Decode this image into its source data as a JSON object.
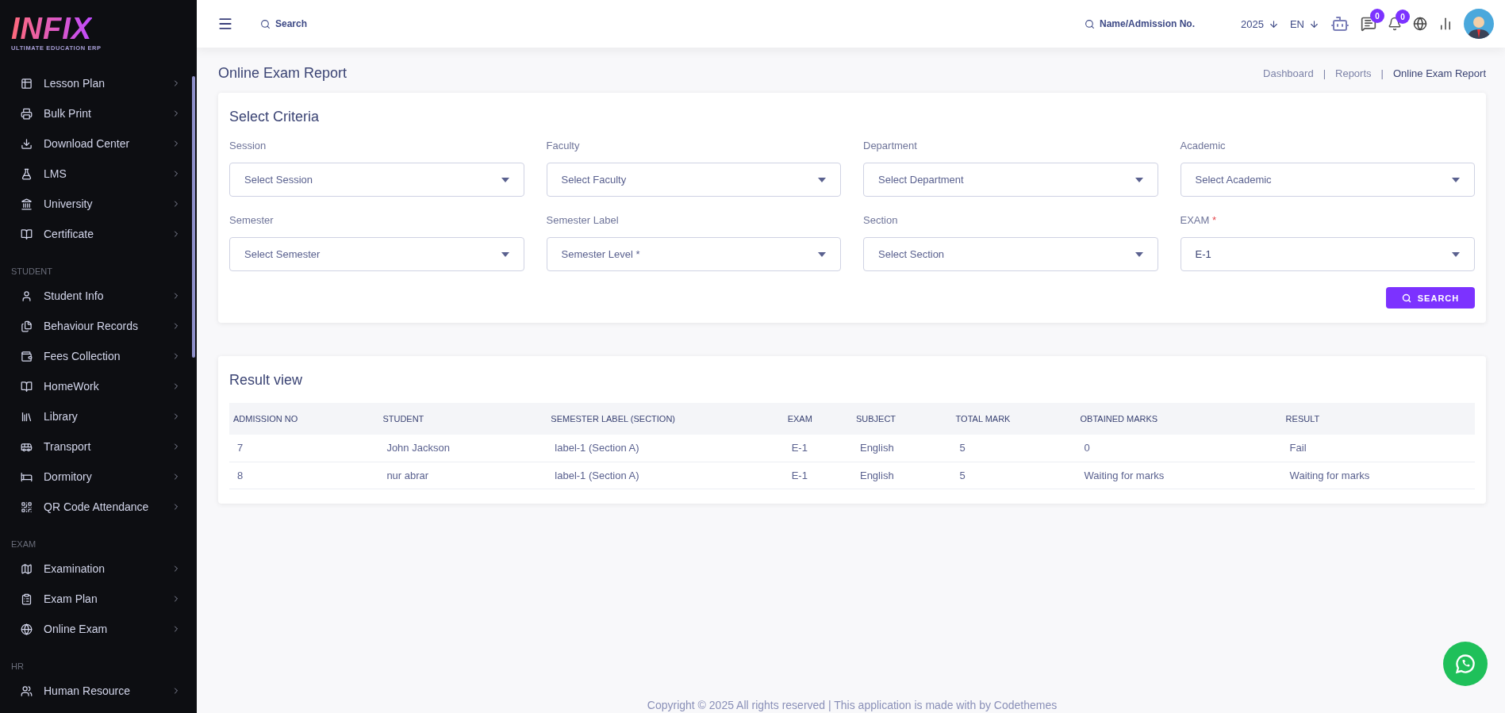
{
  "logo": {
    "wordmark": "INFIX",
    "tagline": "ULTIMATE EDUCATION ERP"
  },
  "sidebar": {
    "sections": [
      {
        "items": [
          {
            "label": "Lesson Plan"
          },
          {
            "label": "Bulk Print"
          },
          {
            "label": "Download Center"
          },
          {
            "label": "LMS"
          },
          {
            "label": "University"
          },
          {
            "label": "Certificate"
          }
        ]
      },
      {
        "title": "STUDENT",
        "items": [
          {
            "label": "Student Info"
          },
          {
            "label": "Behaviour Records"
          },
          {
            "label": "Fees Collection"
          },
          {
            "label": "HomeWork"
          },
          {
            "label": "Library"
          },
          {
            "label": "Transport"
          },
          {
            "label": "Dormitory"
          },
          {
            "label": "QR Code Attendance"
          }
        ]
      },
      {
        "title": "EXAM",
        "items": [
          {
            "label": "Examination"
          },
          {
            "label": "Exam Plan"
          },
          {
            "label": "Online Exam"
          }
        ]
      },
      {
        "title": "HR",
        "items": [
          {
            "label": "Human Resource"
          }
        ]
      }
    ]
  },
  "header": {
    "search": "Search",
    "student_search": "Name/Admission No.",
    "year": "2025",
    "language": "EN",
    "message_count": "0",
    "notification_count": "0"
  },
  "page": {
    "title": "Online Exam Report",
    "breadcrumb": [
      {
        "kind": "link",
        "text": "Dashboard"
      },
      {
        "kind": "separator",
        "text": "|"
      },
      {
        "kind": "link",
        "text": "Reports"
      },
      {
        "kind": "separator",
        "text": "|"
      },
      {
        "kind": "current",
        "text": "Online Exam Report"
      }
    ]
  },
  "criteria": {
    "title": "Select Criteria",
    "fields": [
      {
        "label": "Session",
        "placeholder": "Select Session"
      },
      {
        "label": "Faculty",
        "placeholder": "Select Faculty"
      },
      {
        "label": "Department",
        "placeholder": "Select Department"
      },
      {
        "label": "Academic",
        "placeholder": "Select Academic"
      },
      {
        "label": "Semester",
        "placeholder": "Select Semester"
      },
      {
        "label": "Semester Label",
        "placeholder": "Semester Level *"
      },
      {
        "label": "Section",
        "placeholder": "Select Section"
      },
      {
        "label": "EXAM",
        "required_mark": "*",
        "value": "E-1"
      }
    ],
    "button": "SEARCH"
  },
  "results": {
    "title": "Result view",
    "table": {
      "columns": [
        "ADMISSION NO",
        "STUDENT",
        "SEMESTER LABEL (SECTION)",
        "EXAM",
        "SUBJECT",
        "TOTAL MARK",
        "OBTAINED MARKS",
        "RESULT"
      ],
      "rows": [
        [
          "7",
          "John Jackson",
          "label-1 (Section A)",
          "E-1",
          "English",
          "5",
          "0",
          "Fail"
        ],
        [
          "8",
          "nur abrar",
          "label-1 (Section A)",
          "E-1",
          "English",
          "5",
          "Waiting for marks",
          "Waiting for marks"
        ]
      ]
    }
  },
  "footer": "Copyright © 2025 All rights reserved | This application is made with by Codethemes"
}
